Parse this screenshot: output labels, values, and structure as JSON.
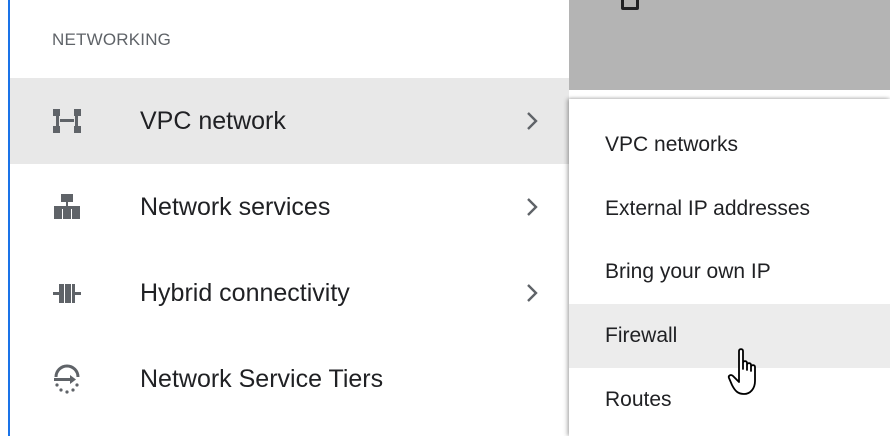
{
  "nav": {
    "section_heading": "NETWORKING",
    "items": [
      {
        "label": "VPC network",
        "icon": "vpc-network-icon",
        "has_submenu": true,
        "active": true
      },
      {
        "label": "Network services",
        "icon": "network-services-icon",
        "has_submenu": true,
        "active": false
      },
      {
        "label": "Hybrid connectivity",
        "icon": "hybrid-connectivity-icon",
        "has_submenu": true,
        "active": false
      },
      {
        "label": "Network Service Tiers",
        "icon": "network-service-tiers-icon",
        "has_submenu": false,
        "active": false
      }
    ]
  },
  "submenu": {
    "items": [
      {
        "label": "VPC networks"
      },
      {
        "label": "External IP addresses"
      },
      {
        "label": "Bring your own IP"
      },
      {
        "label": "Firewall",
        "hovered": true
      },
      {
        "label": "Routes"
      }
    ]
  },
  "colors": {
    "accent": "#1a73e8",
    "active_row": "#e8e8e8",
    "text": "#202124",
    "heading": "#5f6368",
    "icon": "#5f6368"
  }
}
